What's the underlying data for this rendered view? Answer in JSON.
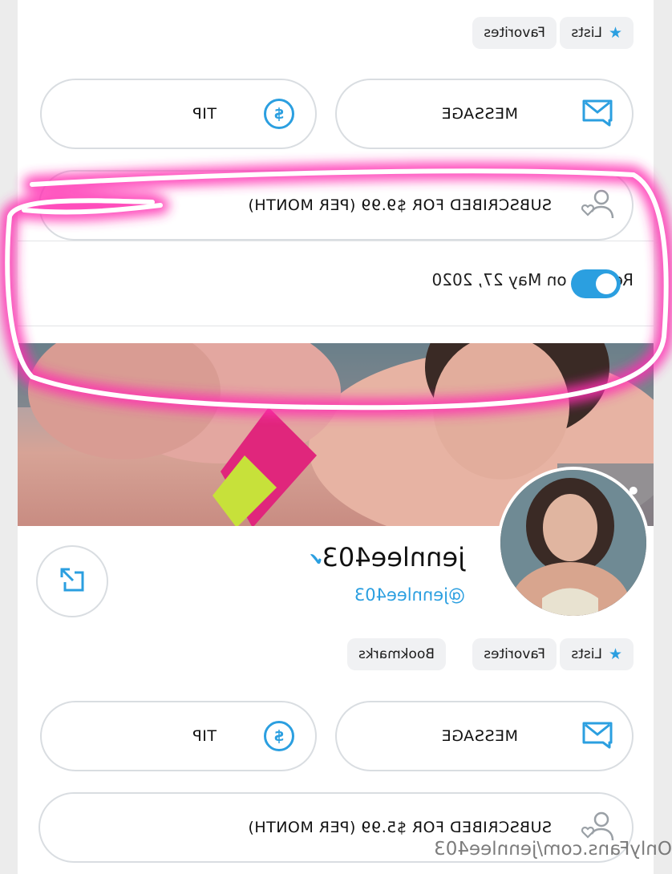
{
  "top_section": {
    "chips": [
      "Lists",
      "Favorites"
    ],
    "message_label": "MESSAGE",
    "tip_label": "TIP",
    "subscribed_label": "SUBSCRIBED FOR $9.99 (PER MONTH)",
    "renew_text": "Renews on May 27, 2020",
    "auto_renew_on": true
  },
  "profile": {
    "display_name": "jennlee403",
    "handle": "@jennlee403",
    "more_label": "•••"
  },
  "bottom_section": {
    "chips": [
      "Lists",
      "Favorites",
      "Bookmarks"
    ],
    "message_label": "MESSAGE",
    "tip_label": "TIP",
    "subscribed_label": "SUBSCRIBED FOR $5.99 (PER MONTH)"
  },
  "watermark": "OnlyFans.com/jennlee403",
  "colors": {
    "accent": "#2b9fe0",
    "highlight": "#ff2fb1"
  },
  "icons": [
    "star-icon",
    "envelope-icon",
    "dollar-icon",
    "user-heart-icon",
    "share-icon",
    "verified-icon",
    "more-icon"
  ]
}
